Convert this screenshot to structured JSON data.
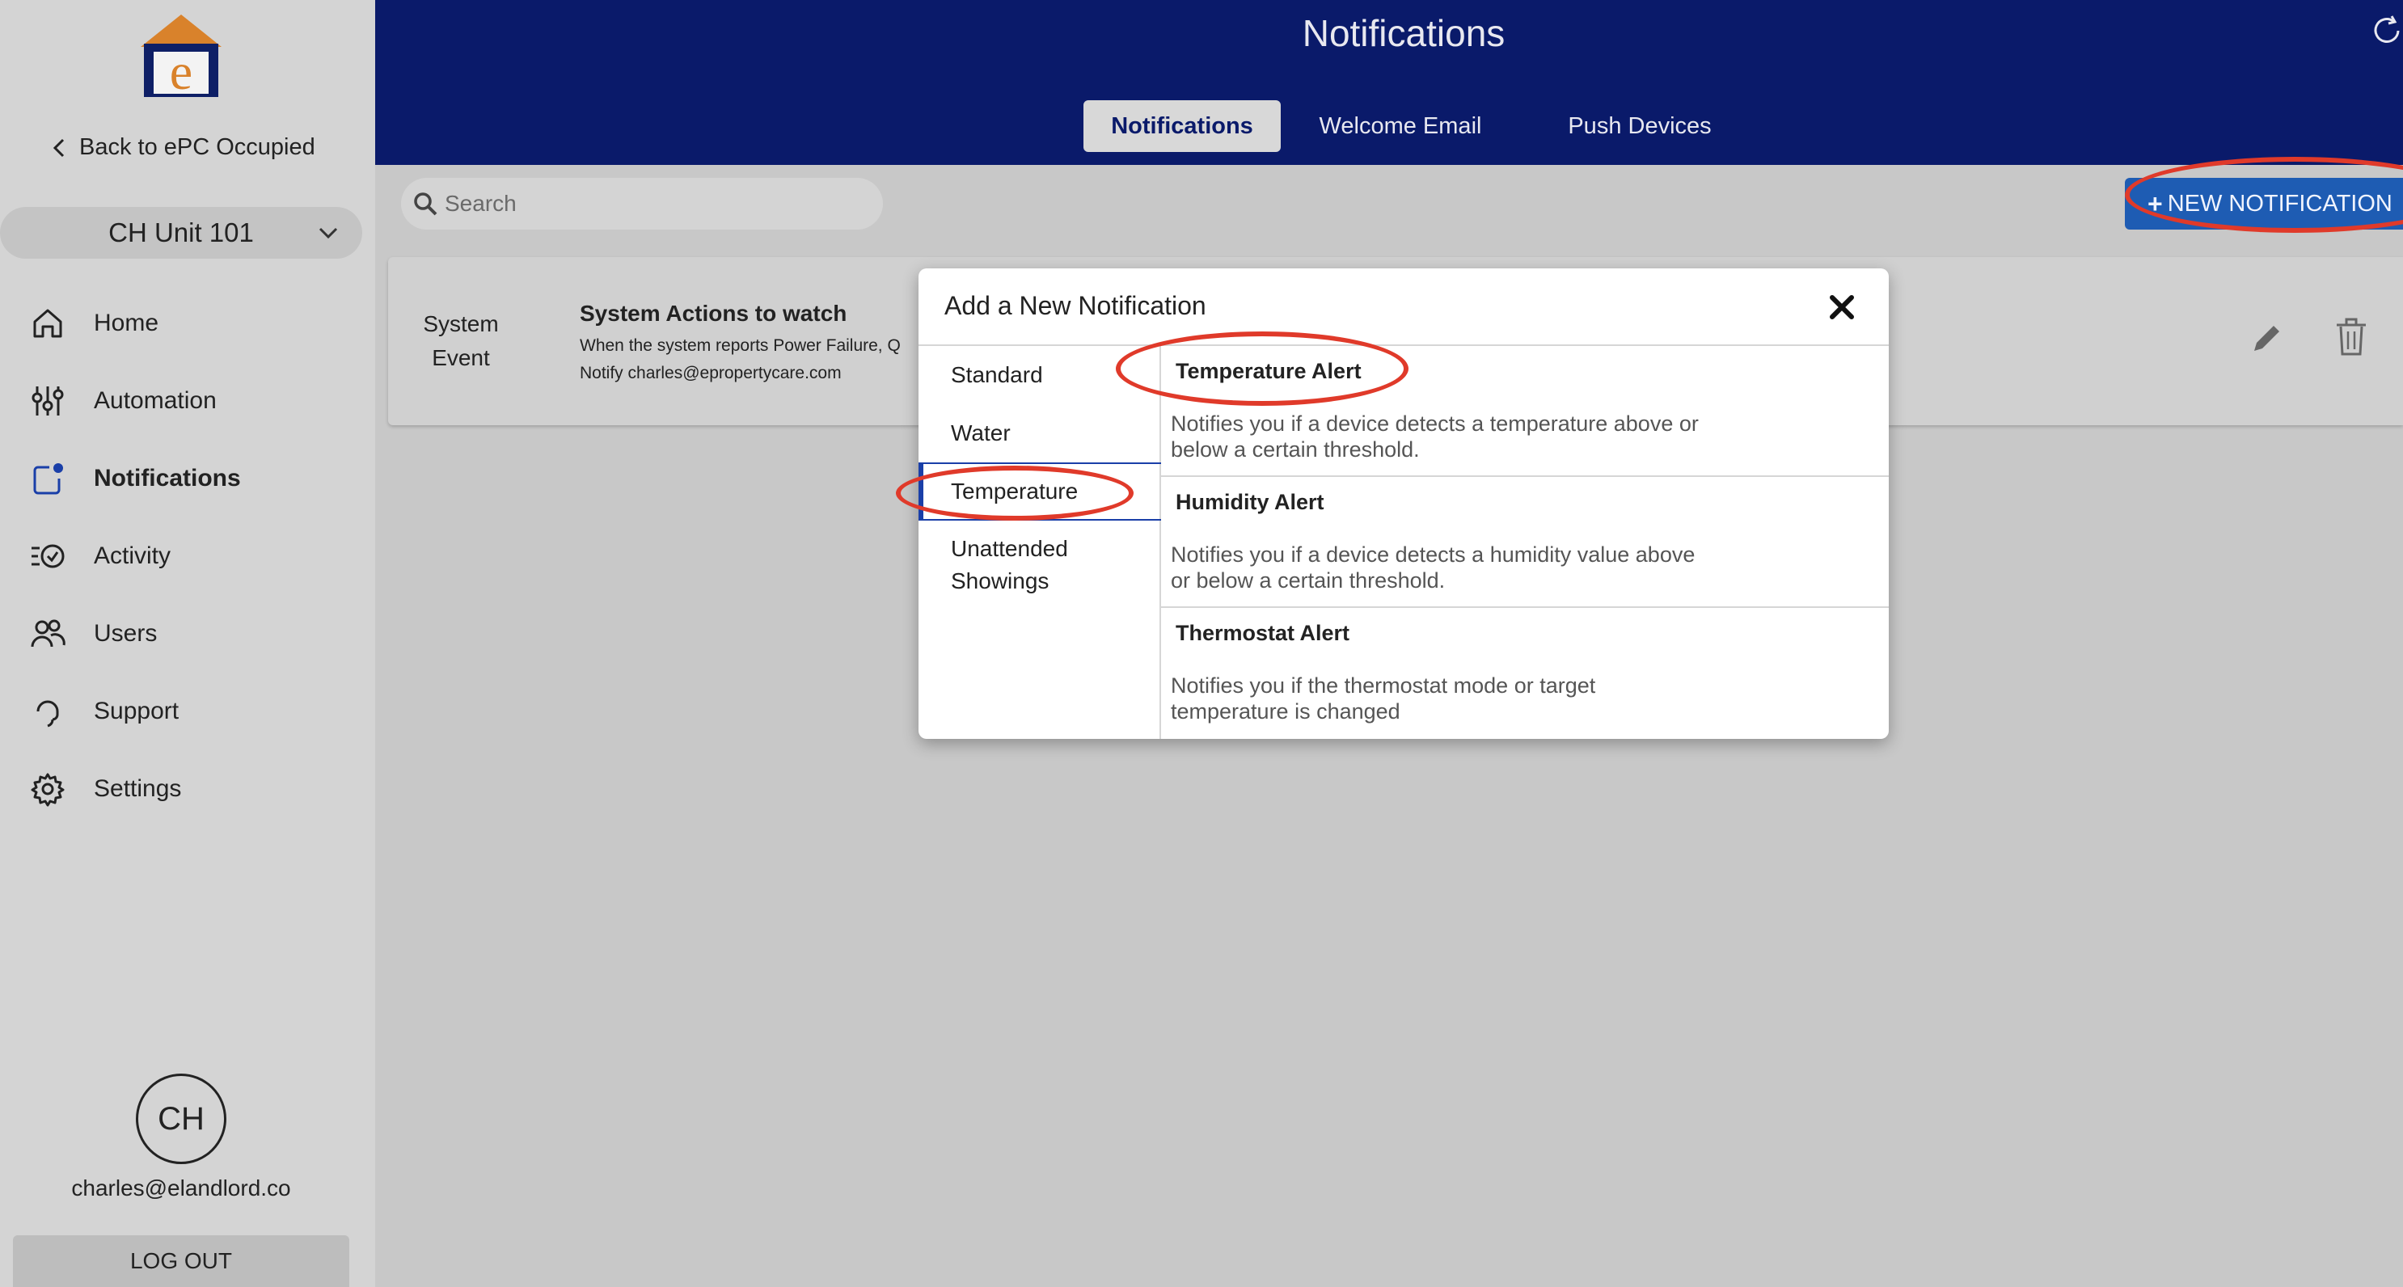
{
  "sidebar": {
    "back_label": "Back to ePC Occupied",
    "unit_name": "CH Unit 101",
    "nav": [
      {
        "label": "Home",
        "icon": "home-icon"
      },
      {
        "label": "Automation",
        "icon": "sliders-icon"
      },
      {
        "label": "Notifications",
        "icon": "notification-icon",
        "active": true
      },
      {
        "label": "Activity",
        "icon": "activity-icon"
      },
      {
        "label": "Users",
        "icon": "users-icon"
      },
      {
        "label": "Support",
        "icon": "headset-icon"
      },
      {
        "label": "Settings",
        "icon": "gear-icon"
      }
    ],
    "avatar_initials": "CH",
    "user_email": "charles@elandlord.co",
    "logout_label": "LOG OUT"
  },
  "header": {
    "title": "Notifications",
    "tabs": [
      {
        "label": "Notifications",
        "active": true
      },
      {
        "label": "Welcome Email"
      },
      {
        "label": "Push Devices"
      }
    ]
  },
  "toolbar": {
    "search_placeholder": "Search",
    "new_button_label": "NEW NOTIFICATION"
  },
  "rows": [
    {
      "type_line1": "System",
      "type_line2": "Event",
      "title": "System Actions to watch",
      "description": "When the system reports Power Failure, Q",
      "notify": "Notify charles@epropertycare.com"
    }
  ],
  "modal": {
    "title": "Add a New Notification",
    "categories": [
      "Standard",
      "Water",
      "Temperature",
      "Unattended Showings"
    ],
    "selected_category": "Temperature",
    "alerts": [
      {
        "title": "Temperature Alert",
        "description": "Notifies you if a device detects a temperature above or below a certain threshold."
      },
      {
        "title": "Humidity Alert",
        "description": "Notifies you if a device detects a humidity value above or below a certain threshold."
      },
      {
        "title": "Thermostat Alert",
        "description": "Notifies you if the thermostat mode or target temperature is changed"
      }
    ]
  },
  "colors": {
    "header_bg": "#0a1a6a",
    "primary_button": "#1e5cb3",
    "annotation_ring": "#e03a2a",
    "selected_accent": "#1a3fa8"
  }
}
